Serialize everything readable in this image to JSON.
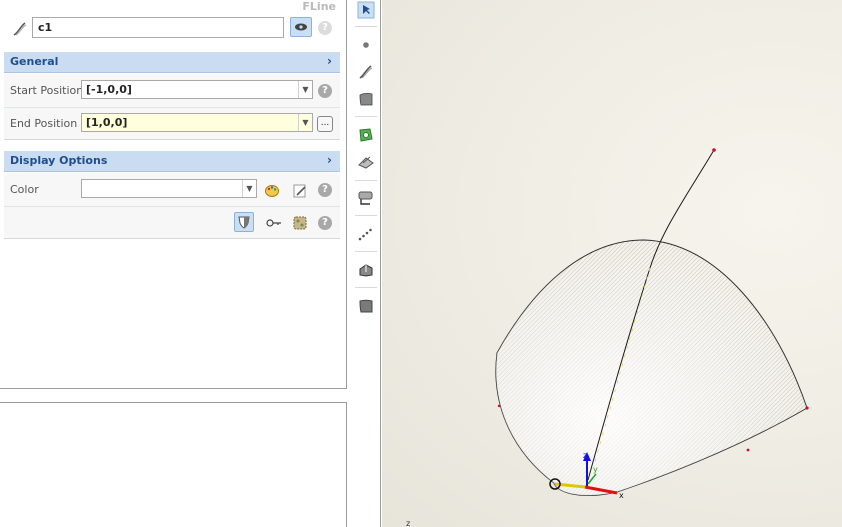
{
  "panel": {
    "type_label": "FLine",
    "name_value": "c1",
    "sections": {
      "general": {
        "title": "General",
        "start_position": {
          "label": "Start Position",
          "value": "[-1,0,0]"
        },
        "end_position": {
          "label": "End Position",
          "value": "[1,0,0]"
        }
      },
      "display": {
        "title": "Display Options",
        "color": {
          "label": "Color",
          "value": ""
        }
      }
    },
    "help_glyph": "?",
    "ellipsis_glyph": "...",
    "chevron_glyph": "›",
    "dropdown_glyph": "▼"
  },
  "toolbar": {
    "icons": [
      "select-icon",
      "point-icon",
      "curve-icon",
      "surface-icon",
      "tagged-point-icon",
      "plane-icon",
      "label-icon",
      "point-set-icon",
      "solid-icon",
      "patch-icon"
    ]
  },
  "viewport": {
    "axis_labels": {
      "x": "x",
      "y": "y",
      "z": "z",
      "corner": "z"
    },
    "colors": {
      "x_axis": "#e01010",
      "y_axis": "#22a022",
      "z_axis": "#1010e0",
      "point": "#c81030"
    }
  }
}
